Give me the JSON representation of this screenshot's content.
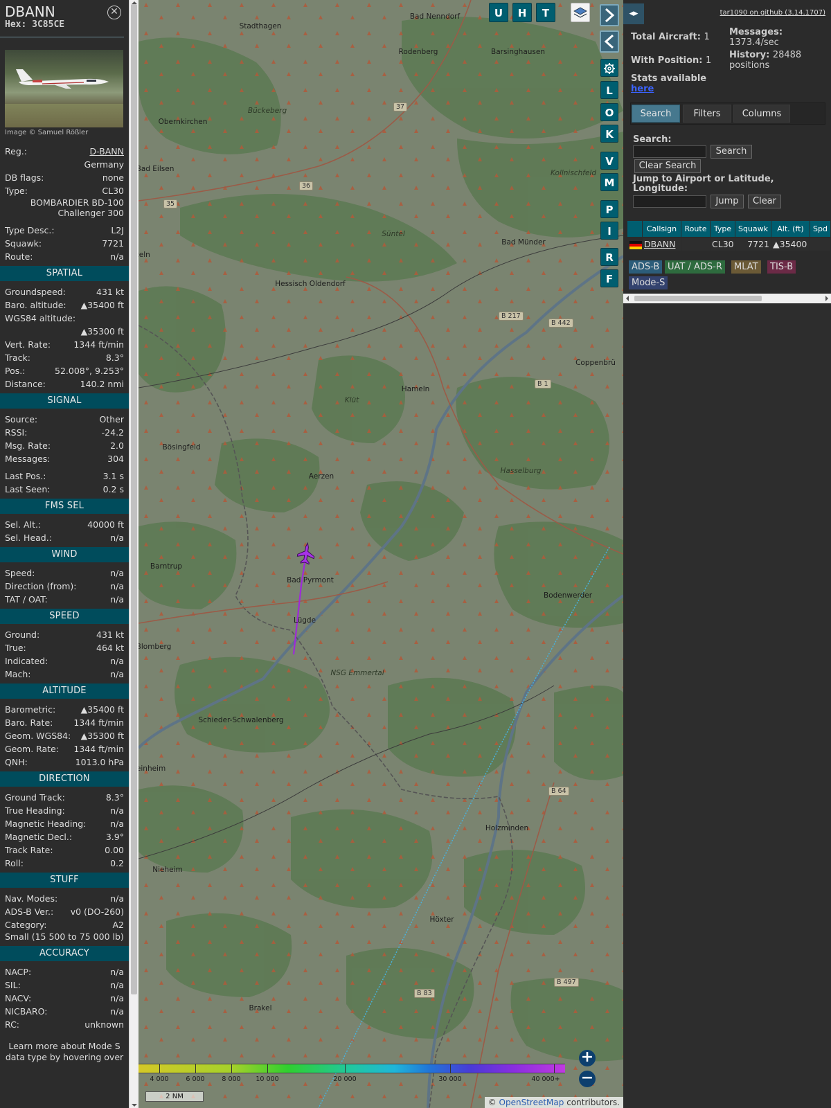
{
  "aircraft": {
    "callsign": "DBANN",
    "hex_label": "Hex:",
    "hex": "3C85CE",
    "photo_credit": "Image © Samuel Rößler",
    "basic": [
      {
        "k": "Reg.:",
        "v": "D-BANN",
        "link": true
      },
      {
        "k": "",
        "v": "Germany"
      },
      {
        "k": "DB flags:",
        "v": "none"
      },
      {
        "k": "Type:",
        "v": "CL30"
      },
      {
        "k": "",
        "v": "BOMBARDIER BD-100 Challenger 300",
        "wrap": true
      },
      {
        "k": "gap"
      },
      {
        "k": "Type Desc.:",
        "v": "L2J"
      },
      {
        "k": "Squawk:",
        "v": "7721"
      },
      {
        "k": "Route:",
        "v": "n/a"
      }
    ],
    "sections": [
      {
        "title": "SPATIAL",
        "rows": [
          {
            "k": "Groundspeed:",
            "v": "431 kt"
          },
          {
            "k": "Baro. altitude:",
            "v": "▲35400 ft"
          },
          {
            "k": "WGS84 altitude:",
            "v": ""
          },
          {
            "k": "",
            "v": "▲35300 ft"
          },
          {
            "k": "Vert. Rate:",
            "v": "1344 ft/min"
          },
          {
            "k": "Track:",
            "v": "8.3°"
          },
          {
            "k": "Pos.:",
            "v": "52.008°, 9.253°"
          },
          {
            "k": "Distance:",
            "v": "140.2 nmi"
          }
        ]
      },
      {
        "title": "SIGNAL",
        "rows": [
          {
            "k": "Source:",
            "v": "Other"
          },
          {
            "k": "RSSI:",
            "v": "-24.2"
          },
          {
            "k": "Msg. Rate:",
            "v": "2.0"
          },
          {
            "k": "Messages:",
            "v": "304"
          },
          {
            "k": "gap"
          },
          {
            "k": "Last Pos.:",
            "v": "3.1 s"
          },
          {
            "k": "Last Seen:",
            "v": "0.2 s"
          }
        ]
      },
      {
        "title": "FMS SEL",
        "rows": [
          {
            "k": "Sel. Alt.:",
            "v": "40000 ft"
          },
          {
            "k": "Sel. Head.:",
            "v": "n/a"
          }
        ]
      },
      {
        "title": "WIND",
        "rows": [
          {
            "k": "Speed:",
            "v": "n/a"
          },
          {
            "k": "Direction (from):",
            "v": "n/a"
          },
          {
            "k": "TAT / OAT:",
            "v": "n/a"
          }
        ]
      },
      {
        "title": "SPEED",
        "rows": [
          {
            "k": "Ground:",
            "v": "431 kt"
          },
          {
            "k": "True:",
            "v": "464 kt"
          },
          {
            "k": "Indicated:",
            "v": "n/a"
          },
          {
            "k": "Mach:",
            "v": "n/a"
          }
        ]
      },
      {
        "title": "ALTITUDE",
        "rows": [
          {
            "k": "Barometric:",
            "v": "▲35400 ft"
          },
          {
            "k": "Baro. Rate:",
            "v": "1344 ft/min"
          },
          {
            "k": "Geom. WGS84:",
            "v": "▲35300 ft"
          },
          {
            "k": "Geom. Rate:",
            "v": "1344 ft/min"
          },
          {
            "k": "QNH:",
            "v": "1013.0 hPa"
          }
        ]
      },
      {
        "title": "DIRECTION",
        "rows": [
          {
            "k": "Ground Track:",
            "v": "8.3°"
          },
          {
            "k": "True Heading:",
            "v": "n/a"
          },
          {
            "k": "Magnetic Heading:",
            "v": "n/a"
          },
          {
            "k": "Magnetic Decl.:",
            "v": "3.9°"
          },
          {
            "k": "Track Rate:",
            "v": "0.00"
          },
          {
            "k": "Roll:",
            "v": "0.2"
          }
        ]
      },
      {
        "title": "STUFF",
        "rows": [
          {
            "k": "Nav. Modes:",
            "v": "n/a"
          },
          {
            "k": "ADS-B Ver.:",
            "v": "v0 (DO-260)"
          },
          {
            "k": "Category:",
            "v": "A2"
          },
          {
            "k": "Small (15 500 to 75 000 lb)",
            "v": "",
            "wrap": true
          }
        ]
      },
      {
        "title": "ACCURACY",
        "rows": [
          {
            "k": "NACP:",
            "v": "n/a"
          },
          {
            "k": "SIL:",
            "v": "n/a"
          },
          {
            "k": "NACV:",
            "v": "n/a"
          },
          {
            "k": "NICBARO:",
            "v": "n/a"
          },
          {
            "k": "RC:",
            "v": "unknown"
          }
        ]
      }
    ],
    "footer_note": "Learn more about Mode S data type by hovering over"
  },
  "map": {
    "buttons_top": [
      "U",
      "H",
      "T"
    ],
    "buttons_side": [
      "L",
      "O",
      "K",
      "V",
      "M",
      "P",
      "I",
      "R",
      "F"
    ],
    "places": [
      {
        "name": "Bad Nenndorf"
      },
      {
        "name": "Stadthagen"
      },
      {
        "name": "Rodenberg"
      },
      {
        "name": "Barsinghausen"
      },
      {
        "name": "Bückeberg",
        "italic": true
      },
      {
        "name": "Obernkirchen"
      },
      {
        "name": "Bad Eilsen"
      },
      {
        "name": "Süntel",
        "italic": true
      },
      {
        "name": "Bad Münder"
      },
      {
        "name": "Hessisch Oldendorf"
      },
      {
        "name": "Coppenbrü"
      },
      {
        "name": "Hameln"
      },
      {
        "name": "Klüt",
        "italic": true
      },
      {
        "name": "Bösingfeld"
      },
      {
        "name": "Aerzen"
      },
      {
        "name": "Hasselburg",
        "italic": true
      },
      {
        "name": "Barntrup"
      },
      {
        "name": "Bad Pyrmont"
      },
      {
        "name": "Bodenwerder"
      },
      {
        "name": "Lügde"
      },
      {
        "name": "Blomberg"
      },
      {
        "name": "NSG Emmertal",
        "italic": true
      },
      {
        "name": "Schieder-Schwalenberg"
      },
      {
        "name": "teinheim"
      },
      {
        "name": "Holzminden"
      },
      {
        "name": "Nieheim"
      },
      {
        "name": "Höxter"
      },
      {
        "name": "Brakel"
      },
      {
        "name": "Kollnischfeld",
        "italic": true
      },
      {
        "name": "zeln"
      }
    ],
    "roads": [
      "B 217",
      "B 442",
      "B 1",
      "B 64",
      "B 497",
      "B 83",
      "37",
      "36",
      "35"
    ],
    "altitude_scale": [
      "4 000",
      "6 000",
      "8 000",
      "10 000",
      "20 000",
      "30 000",
      "40 000+"
    ],
    "scale_bar": "2 NM",
    "attribution_prefix": "© ",
    "attribution_link": "OpenStreetMap",
    "attribution_suffix": " contributors."
  },
  "sidebar": {
    "toggle": "◂▸",
    "github": "tar1090 on github (3.14.1707)",
    "total_aircraft_label": "Total Aircraft:",
    "total_aircraft": "1",
    "with_position_label": "With Position:",
    "with_position": "1",
    "messages_label": "Messages:",
    "messages": "1373.4/sec",
    "history_label": "History:",
    "history": "28488 positions",
    "stats_label": "Stats available",
    "stats_link": "here",
    "tabs": [
      "Search",
      "Filters",
      "Columns"
    ],
    "search_label": "Search:",
    "search_button": "Search",
    "clear_search_button": "Clear Search",
    "jump_label": "Jump to Airport or Latitude, Longitude:",
    "jump_button": "Jump",
    "clear_button": "Clear",
    "table": {
      "columns": [
        "Callsign",
        "Route",
        "Type",
        "Squawk",
        "Alt. (ft)",
        "Spd"
      ],
      "rows": [
        {
          "callsign": "DBANN",
          "route": "",
          "type": "CL30",
          "squawk": "7721",
          "alt": "▲35400",
          "spd": ""
        }
      ]
    },
    "legend": [
      {
        "label": "ADS-B",
        "color": "#2c5d7a"
      },
      {
        "label": "UAT / ADS-R",
        "color": "#2e6b3e"
      },
      {
        "label": "MLAT",
        "color": "#6b5a36"
      },
      {
        "label": "TIS-B",
        "color": "#6b2a46"
      },
      {
        "label": "Mode-S",
        "color": "#33426e"
      }
    ]
  }
}
